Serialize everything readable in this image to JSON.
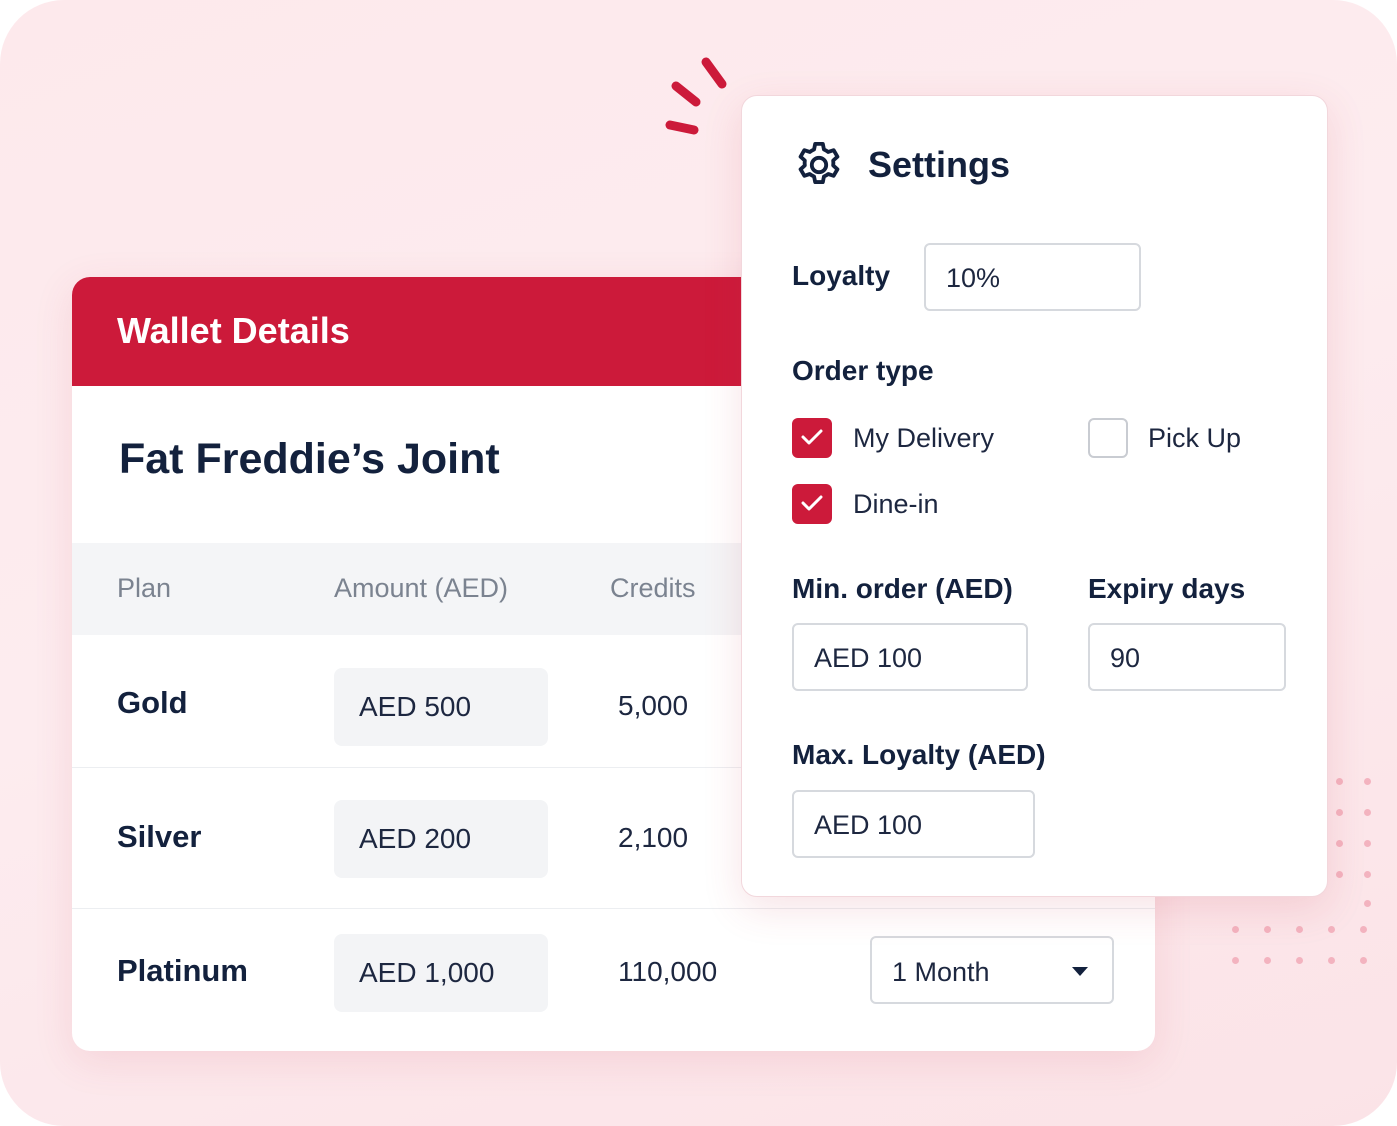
{
  "colors": {
    "brand": "#cc1a3a",
    "background": "#fdecef",
    "text": "#13213d"
  },
  "wallet": {
    "title": "Wallet Details",
    "shop_name": "Fat Freddie’s Joint",
    "columns": [
      "Plan",
      "Amount (AED)",
      "Credits"
    ],
    "rows": [
      {
        "plan": "Gold",
        "amount": "AED 500",
        "credits": "5,000"
      },
      {
        "plan": "Silver",
        "amount": "AED 200",
        "credits": "2,100"
      },
      {
        "plan": "Platinum",
        "amount": "AED 1,000",
        "credits": "110,000",
        "expiry": "1 Month"
      }
    ]
  },
  "settings": {
    "title": "Settings",
    "icon": "gear-icon",
    "loyalty": {
      "label": "Loyalty",
      "value": "10%"
    },
    "order_type": {
      "label": "Order type",
      "options": [
        {
          "label": "My Delivery",
          "checked": true
        },
        {
          "label": "Pick Up",
          "checked": false
        },
        {
          "label": "Dine-in",
          "checked": true
        }
      ]
    },
    "min_order": {
      "label": "Min. order (AED)",
      "value": "AED 100"
    },
    "expiry_days": {
      "label": "Expiry days",
      "value": "90"
    },
    "max_loyalty": {
      "label": "Max. Loyalty (AED)",
      "value": "AED 100"
    }
  }
}
